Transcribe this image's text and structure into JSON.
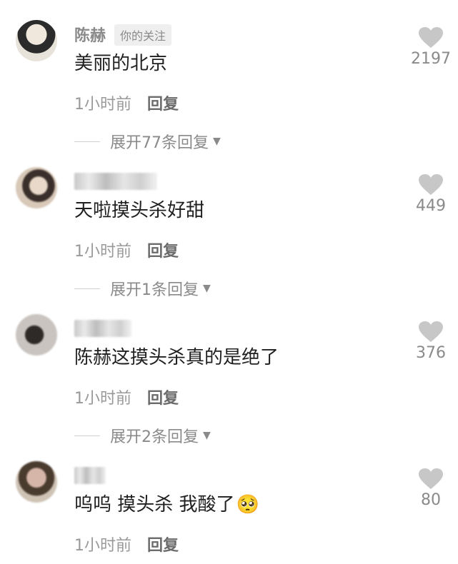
{
  "comments": [
    {
      "username": "陈赫",
      "follow_tag": "你的关注",
      "text": "美丽的北京",
      "time": "1小时前",
      "reply_label": "回复",
      "expand_label": "展开77条回复",
      "likes": "2197",
      "avatar_colors": [
        "#e8e3da",
        "#2b2b2b"
      ]
    },
    {
      "username": "",
      "text": "天啦摸头杀好甜",
      "time": "1小时前",
      "reply_label": "回复",
      "expand_label": "展开1条回复",
      "likes": "449",
      "avatar_colors": [
        "#d8c8b8",
        "#3a2f2a"
      ]
    },
    {
      "username": "",
      "text": "陈赫这摸头杀真的是绝了",
      "time": "1小时前",
      "reply_label": "回复",
      "expand_label": "展开2条回复",
      "likes": "376",
      "avatar_colors": [
        "#c9c4c0",
        "#2e2a28"
      ]
    },
    {
      "username": "",
      "text": "呜呜 摸头杀 我酸了",
      "emoji": "🥺",
      "time": "1小时前",
      "reply_label": "回复",
      "likes": "80",
      "avatar_colors": [
        "#d6b6a8",
        "#4a3b2f"
      ]
    }
  ],
  "colors": {
    "heart": "#c7c7c7",
    "secondary_text": "#999999",
    "primary_text": "#1f1f1f"
  },
  "icons": {
    "like": "heart-icon",
    "expand": "caret-down-icon"
  }
}
